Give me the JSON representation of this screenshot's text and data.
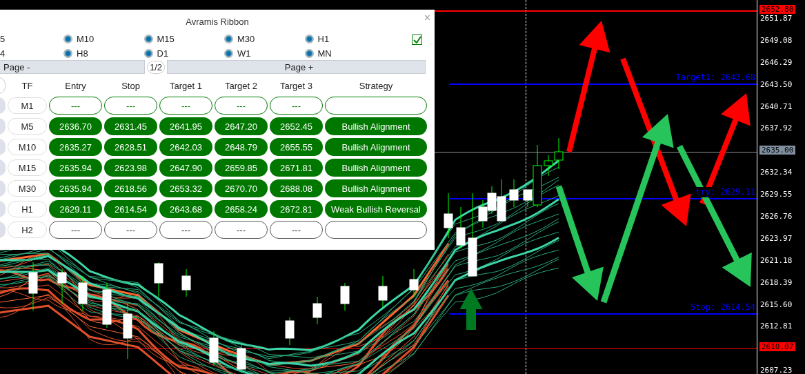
{
  "panel": {
    "title": "Avramis Ribbon",
    "close": "×",
    "checked": true,
    "timeframes": [
      {
        "label": "5"
      },
      {
        "label": "M10",
        "selected": true
      },
      {
        "label": "M15",
        "selected": true
      },
      {
        "label": "M30",
        "selected": true
      },
      {
        "label": "H1",
        "selected": true
      },
      {
        "label": "4"
      },
      {
        "label": "H8",
        "selected": true
      },
      {
        "label": "D1",
        "selected": true
      },
      {
        "label": "W1",
        "selected": true
      },
      {
        "label": "MN",
        "selected": true
      }
    ],
    "pager": {
      "prev": "Page -",
      "page": "1/2",
      "next": "Page +"
    },
    "columns": [
      "TF",
      "Entry",
      "Stop",
      "Target 1",
      "Target 2",
      "Target 3",
      "Strategy"
    ],
    "rows": [
      {
        "kind": "waiting",
        "cells": [
          "M1",
          "---",
          "---",
          "---",
          "---",
          "---",
          ""
        ]
      },
      {
        "kind": "signal",
        "cells": [
          "M5",
          "2636.70",
          "2631.45",
          "2641.95",
          "2647.20",
          "2652.45",
          "Bullish Alignment"
        ]
      },
      {
        "kind": "signal",
        "cells": [
          "M10",
          "2635.27",
          "2628.51",
          "2642.03",
          "2648.79",
          "2655.55",
          "Bullish Alignment"
        ]
      },
      {
        "kind": "signal",
        "cells": [
          "M15",
          "2635.94",
          "2623.98",
          "2647.90",
          "2659.85",
          "2671.81",
          "Bullish Alignment"
        ]
      },
      {
        "kind": "signal",
        "cells": [
          "M30",
          "2635.94",
          "2618.56",
          "2653.32",
          "2670.70",
          "2688.08",
          "Bullish Alignment"
        ]
      },
      {
        "kind": "signal",
        "cells": [
          "H1",
          "2629.11",
          "2614.54",
          "2643.68",
          "2658.24",
          "2672.81",
          "Weak Bullish Reversal"
        ]
      },
      {
        "kind": "none",
        "cells": [
          "H2",
          "---",
          "---",
          "---",
          "---",
          "---",
          ""
        ]
      }
    ]
  },
  "chart": {
    "level_lines": [
      {
        "label": "Target1: 2643.68"
      },
      {
        "label": "try: 2629.11"
      },
      {
        "label": "Stop: 2614.54"
      }
    ],
    "price_ticks": [
      "2651.87",
      "2649.08",
      "2646.29",
      "2643.50",
      "2640.71",
      "2637.92",
      "2632.34",
      "2629.55",
      "2626.76",
      "2623.97",
      "2621.18",
      "2618.39",
      "2615.60",
      "2612.81",
      "2607.23"
    ],
    "price_markers": [
      {
        "label": "2652.80",
        "kind": "alert"
      },
      {
        "label": "2635.00",
        "kind": "current"
      },
      {
        "label": "2610.07",
        "kind": "alert"
      }
    ]
  }
}
